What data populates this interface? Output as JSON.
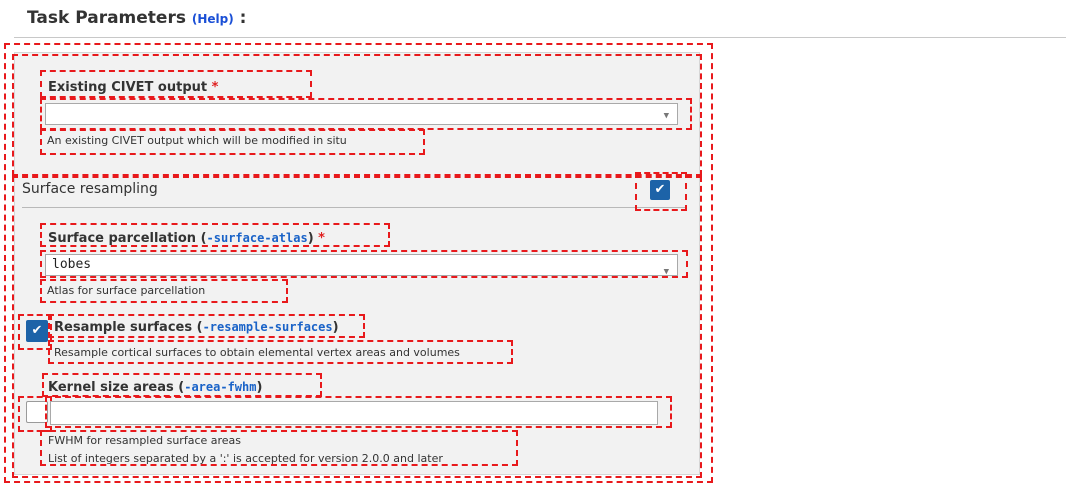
{
  "header": {
    "title": "Task Parameters",
    "help_link": "(Help)",
    "colon": ":"
  },
  "fields": {
    "existing_output": {
      "label": "Existing CIVET output",
      "required_marker": "*",
      "value": "",
      "hint": "An existing CIVET output which will be modified in situ"
    },
    "surface_resampling": {
      "title": "Surface resampling",
      "enabled": true,
      "checkmark": "✔"
    },
    "surface_parcellation": {
      "label": "Surface parcellation (",
      "flag": "-surface-atlas",
      "label_close": ")",
      "required_marker": "*",
      "value": "lobes",
      "hint": "Atlas for surface parcellation"
    },
    "resample_surfaces": {
      "label": "Resample surfaces (",
      "flag": "-resample-surfaces",
      "label_close": ")",
      "checked": true,
      "checkmark": "✔",
      "hint": "Resample cortical surfaces to obtain elemental vertex areas and volumes"
    },
    "kernel_size_areas": {
      "label": "Kernel size areas (",
      "flag": "-area-fwhm",
      "label_close": ")",
      "checked": false,
      "value": "",
      "hint_line1": "FWHM for resampled surface areas",
      "hint_line2": "List of integers separated by a ':' is accepted for version 2.0.0 and later"
    }
  },
  "icons": {
    "dropdown_caret": "▼"
  },
  "colors": {
    "accent_blue": "#1d63a8",
    "link_blue": "#1a4fd6",
    "code_blue": "#1a63c8",
    "required_red": "#e02020",
    "dashed_outline_red": "#e8191c",
    "panel_bg": "#f2f2f2"
  }
}
